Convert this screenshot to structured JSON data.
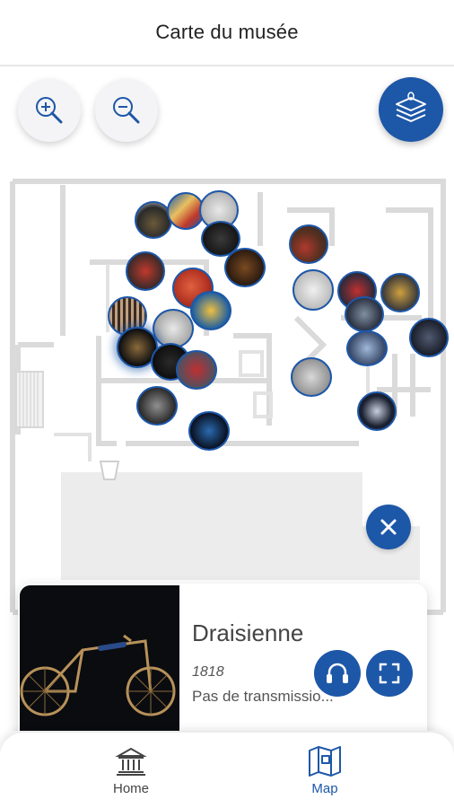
{
  "header": {
    "title": "Carte du musée"
  },
  "map": {
    "zoom_in_icon": "zoom-in-icon",
    "zoom_out_icon": "zoom-out-icon",
    "layers_icon": "layers-icon"
  },
  "selected_item": {
    "title": "Draisienne",
    "year": "1818",
    "description": "Pas de transmissio...",
    "close_icon": "close-icon",
    "audio_icon": "headphones-icon",
    "fullscreen_icon": "fullscreen-icon"
  },
  "bottom_nav": {
    "items": [
      {
        "label": "Home",
        "icon": "museum-icon",
        "active": false
      },
      {
        "label": "Map",
        "icon": "map-icon",
        "active": true
      }
    ]
  },
  "colors": {
    "accent": "#1d57a8",
    "inactive": "#444444"
  }
}
